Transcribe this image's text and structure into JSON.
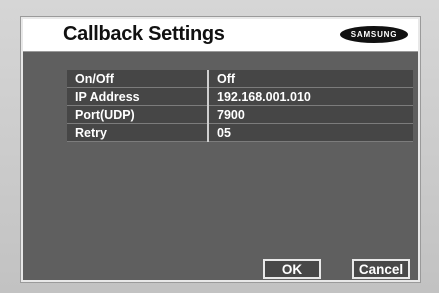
{
  "window": {
    "title": "Callback Settings",
    "brand": "SAMSUNG"
  },
  "settings": [
    {
      "label": "On/Off",
      "value": "Off"
    },
    {
      "label": "IP Address",
      "value": "192.168.001.010"
    },
    {
      "label": "Port(UDP)",
      "value": "7900"
    },
    {
      "label": "Retry",
      "value": "05"
    }
  ],
  "buttons": {
    "ok_label": "OK",
    "cancel_label": "Cancel"
  },
  "colors": {
    "panel_background": "#5f5f5f",
    "row_background": "#464646",
    "title_bar": "#ffffff",
    "text": "#ffffff"
  }
}
